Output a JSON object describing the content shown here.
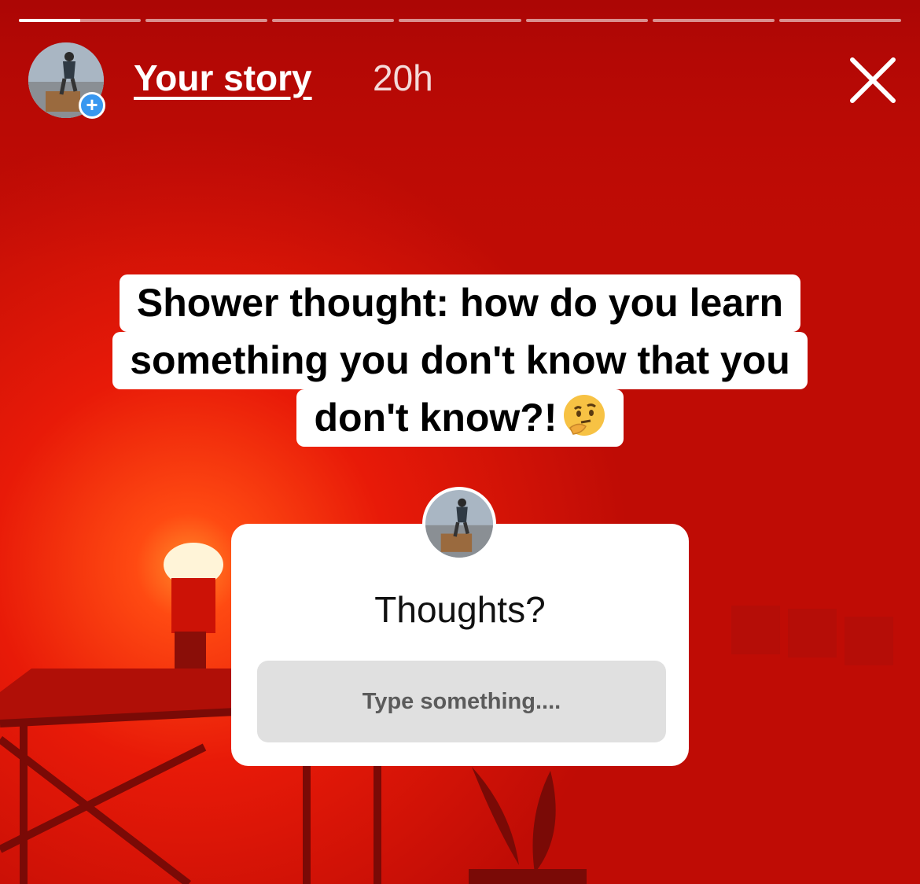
{
  "story": {
    "segments": 7,
    "current_segment": 1,
    "current_progress": 0.5,
    "username": "Your story",
    "time": "20h",
    "avatar_icon": "profile-photo-hiker",
    "add_icon": "plus-icon",
    "close_icon": "close-icon"
  },
  "caption": {
    "lines": [
      "Shower thought: how do you learn",
      "something you don't know that you",
      "don't know?!"
    ],
    "emoji": "thinking-face-icon"
  },
  "question_sticker": {
    "title": "Thoughts?",
    "placeholder": "Type something...."
  },
  "colors": {
    "background": "#d81407",
    "accent_blue": "#3897f0",
    "input_bg": "#e0e0e0"
  }
}
